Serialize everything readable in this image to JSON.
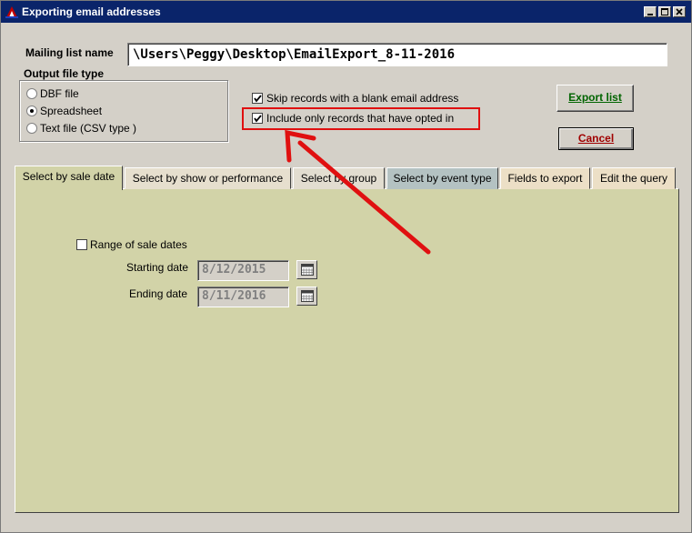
{
  "window": {
    "title": "Exporting email addresses",
    "titlebar_color": "#0a246a"
  },
  "mailing_list": {
    "label": "Mailing list name",
    "value": "\\Users\\Peggy\\Desktop\\EmailExport_8-11-2016"
  },
  "output_type": {
    "label": "Output file type",
    "options": [
      "DBF file",
      "Spreadsheet",
      "Text file (CSV type )"
    ],
    "selected": "Spreadsheet"
  },
  "options": {
    "skip_blank_label": "Skip records with a blank email address",
    "skip_blank_checked": true,
    "opted_in_label": "Include only records that have opted in",
    "opted_in_checked": true
  },
  "buttons": {
    "export": "Export list",
    "cancel": "Cancel"
  },
  "tabs": [
    {
      "label": "Select by sale date",
      "active": true
    },
    {
      "label": "Select by show or performance",
      "active": false
    },
    {
      "label": "Select by group",
      "active": false
    },
    {
      "label": "Select by event type",
      "active": false
    },
    {
      "label": "Fields to export",
      "active": false
    },
    {
      "label": "Edit the query",
      "active": false
    }
  ],
  "sale_date": {
    "range_label": "Range of sale dates",
    "range_checked": false,
    "start_label": "Starting date",
    "start_value": "8/12/2015",
    "end_label": "Ending date",
    "end_value": "8/11/2016"
  },
  "colors": {
    "highlight_red": "#e01010",
    "panel_bg": "#d2d3a8",
    "export_text": "#006400",
    "cancel_text": "#a00000"
  }
}
